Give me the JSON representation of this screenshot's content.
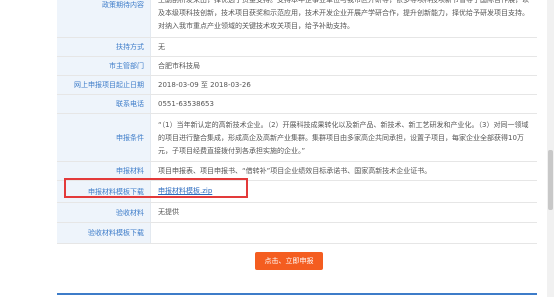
{
  "rows": [
    {
      "label": "政策期待内容",
      "value": "王副剖析发来由，择优选于资金支持。支持本年企事业单位与我市区开研等，依多等项科技项新节省等于国际合作展，以及本级项科技创新，技术项目获奖和示范应用，技术开发企业开展产学研合作，提升创新能力，择优给予研发项目支持。对纳入我市重点产业领域的关键技术攻关项目，给予补助支持。"
    },
    {
      "label": "扶持方式",
      "value": "无"
    },
    {
      "label": "市主管部门",
      "value": "合肥市科技局"
    },
    {
      "label": "网上申报项目起止日期",
      "value": "2018-03-09 至 2018-03-26"
    },
    {
      "label": "联系电话",
      "value": "0551-63538653"
    },
    {
      "label": "申报条件",
      "value": "“（1）当年新认定的高新技术企业。（2）开展科技成果转化以及新产品、新技术、新工艺研发和产业化。（3）对同一领域的项目进行整合集成，形成高企及高新产业集群。集群项目由多家高企共同承担，设置子项目，每家企业全部获得10万元，子项目经费直接拨付到各承担实施的企业。”"
    },
    {
      "label": "申报材料",
      "value": "项目申报表、项目申报书、“借转补”项目企业绩效目标承诺书、国家高新技术企业证书。"
    },
    {
      "label": "申报材料模板下载",
      "value": "申报材料模板.zip"
    },
    {
      "label": "验收材料",
      "value": "无提供"
    },
    {
      "label": "验收材料模板下载",
      "value": ""
    }
  ],
  "apply_button": "点击、立即申报",
  "colors": {
    "label_bg": "#eef4fb",
    "label_text": "#3d7cc9",
    "highlight": "#e33a3a",
    "button": "#f45d20",
    "link": "#2d6cc0"
  }
}
